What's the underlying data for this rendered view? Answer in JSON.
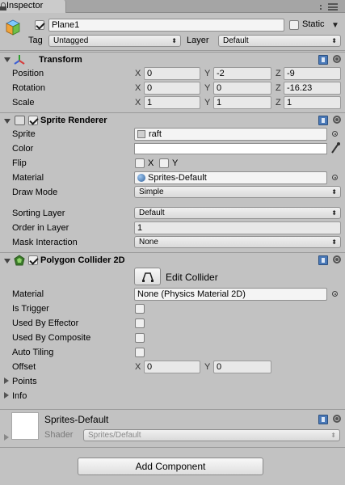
{
  "window": {
    "tab_label": "Inspector"
  },
  "header": {
    "active": true,
    "name": "Plane1",
    "static_label": "Static",
    "static_checked": false,
    "tag_label": "Tag",
    "tag_value": "Untagged",
    "layer_label": "Layer",
    "layer_value": "Default"
  },
  "transform": {
    "title": "Transform",
    "position": {
      "label": "Position",
      "x": "0",
      "y": "-2",
      "z": "-9"
    },
    "rotation": {
      "label": "Rotation",
      "x": "0",
      "y": "0",
      "z": "-16.23"
    },
    "scale": {
      "label": "Scale",
      "x": "1",
      "y": "1",
      "z": "1"
    },
    "axis": {
      "x": "X",
      "y": "Y",
      "z": "Z"
    }
  },
  "sprite_renderer": {
    "title": "Sprite Renderer",
    "enabled": true,
    "sprite_label": "Sprite",
    "sprite_value": "raft",
    "color_label": "Color",
    "color_value": "#ffffff",
    "flip_label": "Flip",
    "flip_x": "X",
    "flip_y": "Y",
    "material_label": "Material",
    "material_value": "Sprites-Default",
    "draw_mode_label": "Draw Mode",
    "draw_mode_value": "Simple",
    "sorting_layer_label": "Sorting Layer",
    "sorting_layer_value": "Default",
    "order_label": "Order in Layer",
    "order_value": "1",
    "mask_label": "Mask Interaction",
    "mask_value": "None"
  },
  "polygon_collider": {
    "title": "Polygon Collider 2D",
    "enabled": true,
    "edit_button": "Edit Collider",
    "material_label": "Material",
    "material_value": "None (Physics Material 2D)",
    "is_trigger_label": "Is Trigger",
    "used_by_effector_label": "Used By Effector",
    "used_by_composite_label": "Used By Composite",
    "auto_tiling_label": "Auto Tiling",
    "offset_label": "Offset",
    "offset_x": "0",
    "offset_y": "0",
    "points_label": "Points",
    "info_label": "Info"
  },
  "material_preview": {
    "name": "Sprites-Default",
    "shader_label": "Shader",
    "shader_value": "Sprites/Default"
  },
  "footer": {
    "add_component": "Add Component"
  }
}
